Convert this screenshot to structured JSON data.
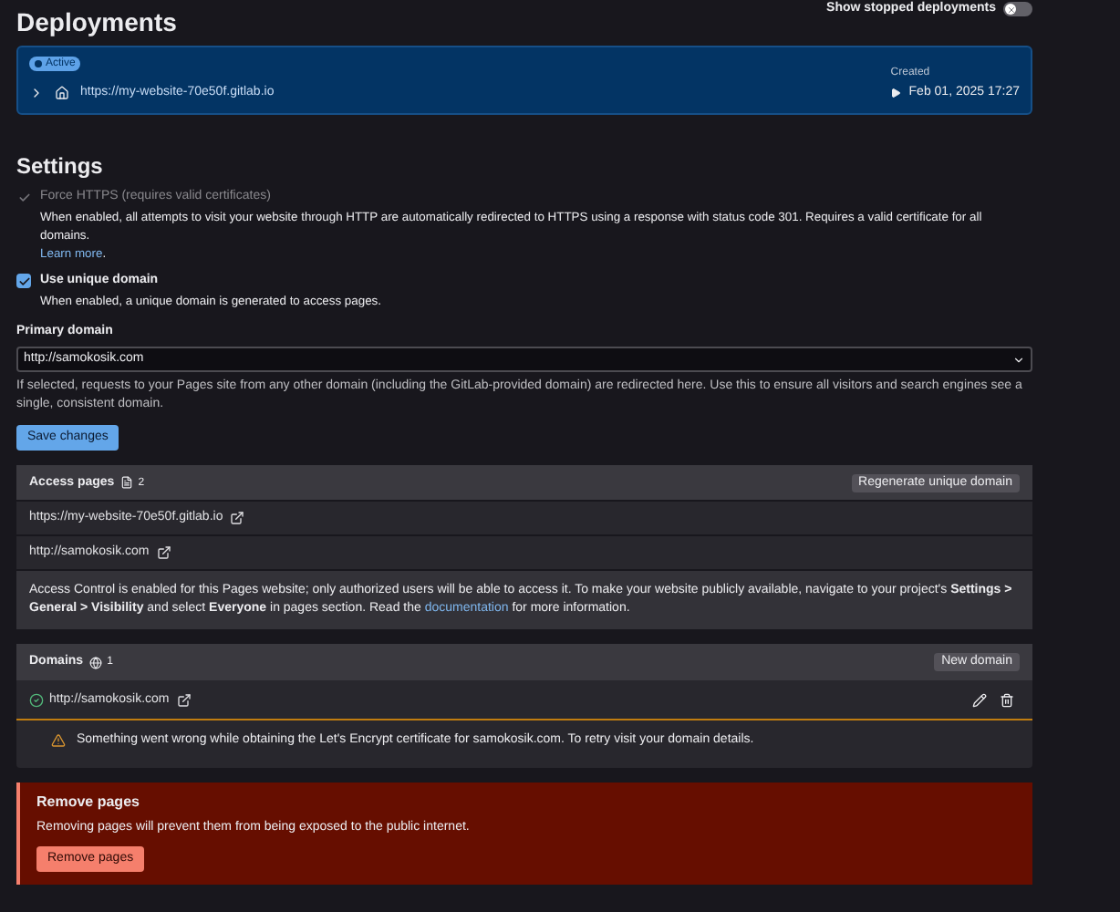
{
  "deployments": {
    "title": "Deployments",
    "show_stopped": {
      "label": "Show stopped deployments",
      "on": false
    },
    "items": [
      {
        "status": "Active",
        "url": "https://my-website-70e50f.gitlab.io",
        "created_label": "Created",
        "created": "Feb 01, 2025 17:27"
      }
    ]
  },
  "settings": {
    "title": "Settings",
    "options": [
      {
        "label": "Force HTTPS (requires valid certificates)",
        "checked": true,
        "disabled": true,
        "description": "When enabled, all attempts to visit your website through HTTP are automatically redirected to HTTPS using a response with status code 301. Requires a valid certificate for all domains.",
        "link": "Learn more",
        "after_link": "."
      },
      {
        "label": "Use unique domain",
        "checked": true,
        "disabled": false,
        "description": "When enabled, a unique domain is generated to access pages."
      }
    ],
    "primary_domain": {
      "label": "Primary domain",
      "value": "http://samokosik.com",
      "help": "If selected, requests to your Pages site from any other domain (including the GitLab-provided domain) are redirected here. Use this to ensure all visitors and search engines see a single, consistent domain."
    },
    "save_button": "Save changes"
  },
  "access_pages": {
    "title": "Access pages",
    "count": "2",
    "button": "Regenerate unique domain",
    "links": [
      "https://my-website-70e50f.gitlab.io",
      "http://samokosik.com"
    ],
    "notice": "Access Control is enabled for this Pages website; only authorized users will be able to access it. To make your website publicly available, navigate to your project's **Settings > General > Visibility** and select **Everyone** in pages section. Read the ",
    "notice_link": "documentation",
    "notice_end": " for more information."
  },
  "domains": {
    "title": "Domains",
    "count": "1",
    "button": "New domain",
    "items": [
      {
        "url": "http://samokosik.com",
        "verified": true,
        "warning": "Something went wrong while obtaining the Let's Encrypt certificate for samokosik.com. To retry visit your domain details."
      }
    ]
  },
  "remove_pages": {
    "title": "Remove pages",
    "description": "Removing pages will prevent them from being exposed to the public internet.",
    "button": "Remove pages"
  }
}
